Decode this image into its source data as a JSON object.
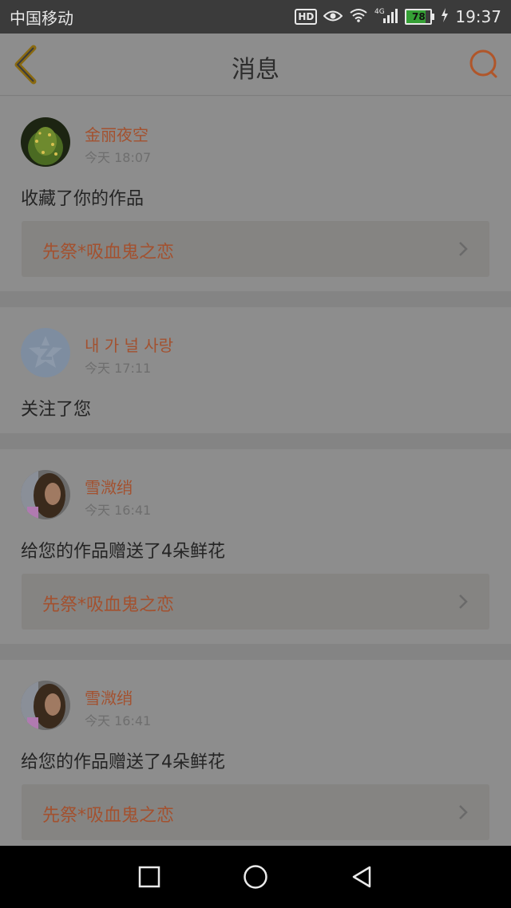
{
  "status_bar": {
    "carrier": "中国移动",
    "hd": "HD",
    "network": "4G",
    "battery": "78",
    "battery_level": 0.78,
    "time": "19:37"
  },
  "header": {
    "title": "消息",
    "back_icon": "chevron-left-icon",
    "search_icon": "search-icon"
  },
  "messages": [
    {
      "username": "金丽夜空",
      "time": "今天 18:07",
      "text": "收藏了你的作品",
      "work": "先祭*吸血鬼之恋",
      "avatar": "cactus-avatar"
    },
    {
      "username": "내 가 널 사랑",
      "time": "今天 17:11",
      "text": "关注了您",
      "work": null,
      "avatar": "default-avatar"
    },
    {
      "username": "雪溦绡",
      "time": "今天 16:41",
      "text": "给您的作品赠送了4朵鲜花",
      "work": "先祭*吸血鬼之恋",
      "avatar": "photo-avatar"
    },
    {
      "username": "雪溦绡",
      "time": "今天 16:41",
      "text": "给您的作品赠送了4朵鲜花",
      "work": "先祭*吸血鬼之恋",
      "avatar": "photo-avatar"
    }
  ],
  "colors": {
    "accent": "#a3512f",
    "back_icon": "#8a6a10",
    "search_icon": "#b0562a"
  },
  "nav_bar": {
    "buttons": [
      "recent-apps-icon",
      "home-icon",
      "back-triangle-icon"
    ]
  }
}
